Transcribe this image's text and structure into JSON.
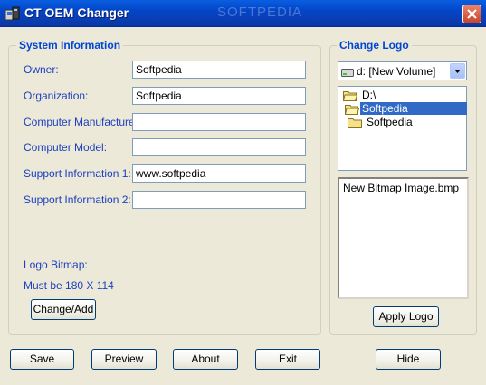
{
  "window": {
    "title": "CT OEM Changer",
    "watermark": "SOFTPEDIA"
  },
  "system_info": {
    "legend": "System Information",
    "fields": [
      {
        "label": "Owner:",
        "value": "Softpedia"
      },
      {
        "label": "Organization:",
        "value": "Softpedia"
      },
      {
        "label": "Computer Manufacturer:",
        "value": ""
      },
      {
        "label": "Computer Model:",
        "value": ""
      },
      {
        "label": "Support Information 1:",
        "value": "www.softpedia"
      },
      {
        "label": "Support Information 2:",
        "value": ""
      }
    ],
    "logo_bitmap_label": "Logo Bitmap:",
    "logo_size_note": "Must be 180 X 114",
    "change_add_button": "Change/Add"
  },
  "change_logo": {
    "legend": "Change Logo",
    "drive_select": "d: [New Volume]",
    "folders": [
      "D:\\",
      "Softpedia",
      "Softpedia"
    ],
    "selected_folder_index": 1,
    "files": [
      "New Bitmap Image.bmp"
    ],
    "apply_button": "Apply Logo"
  },
  "footer": {
    "save": "Save",
    "preview": "Preview",
    "about": "About",
    "exit": "Exit",
    "hide": "Hide"
  },
  "colors": {
    "title_bar": "#0a5ee0",
    "legend_text": "#0046d5",
    "label_text": "#1c3fbf",
    "selection": "#316ac5",
    "dialog_bg": "#ece9d8"
  }
}
